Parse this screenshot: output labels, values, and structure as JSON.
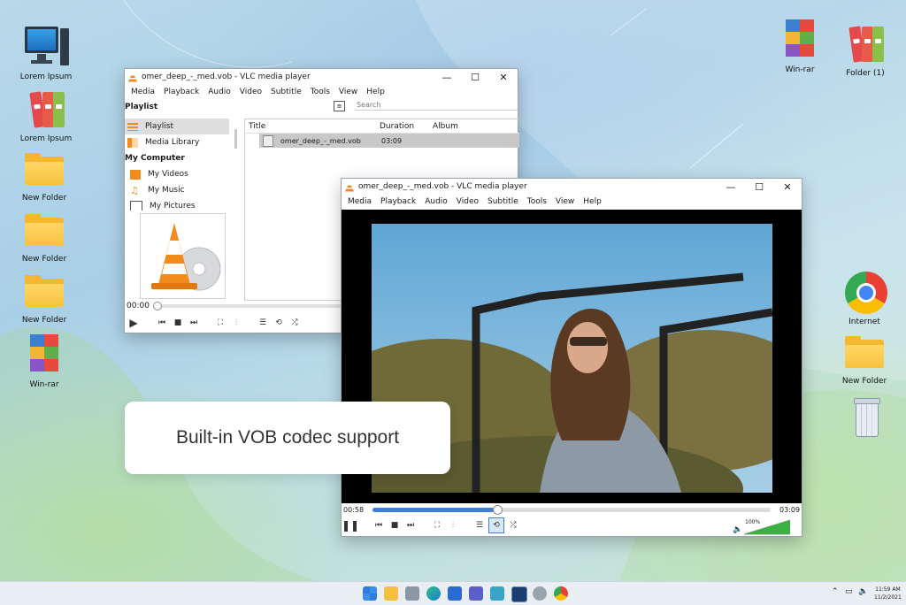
{
  "desktop": {
    "icons_left": [
      {
        "label": "Lorem Ipsum",
        "icon": "computer-icon"
      },
      {
        "label": "Lorem Ipsum",
        "icon": "binders-icon"
      },
      {
        "label": "New Folder",
        "icon": "folder-icon"
      },
      {
        "label": "New Folder",
        "icon": "folder-icon"
      },
      {
        "label": "New Folder",
        "icon": "folder-icon"
      },
      {
        "label": "Win-rar",
        "icon": "winrar-icon"
      }
    ],
    "icons_right": [
      {
        "label": "Win-rar",
        "icon": "winrar-icon"
      },
      {
        "label": "Folder (1)",
        "icon": "binders-icon"
      },
      {
        "label": "Internet",
        "icon": "chrome-icon"
      },
      {
        "label": "New Folder",
        "icon": "folder-icon"
      },
      {
        "label": "",
        "icon": "recycle-bin-icon"
      }
    ]
  },
  "playlist_window": {
    "title": "omer_deep_-_med.vob - VLC media player",
    "menu": [
      "Media",
      "Playback",
      "Audio",
      "Video",
      "Subtitle",
      "Tools",
      "View",
      "Help"
    ],
    "section_title": "Playlist",
    "search_placeholder": "Search",
    "sidebar": {
      "items": [
        "Playlist",
        "Media Library"
      ],
      "group": "My Computer",
      "computer_items": [
        "My Videos",
        "My Music",
        "My Pictures"
      ]
    },
    "columns": [
      "Title",
      "Duration",
      "Album"
    ],
    "rows": [
      {
        "title": "omer_deep_-_med.vob",
        "duration": "03:09",
        "album": ""
      }
    ],
    "time": "00:00"
  },
  "player_window": {
    "title": "omer_deep_-_med.vob - VLC media player",
    "menu": [
      "Media",
      "Playback",
      "Audio",
      "Video",
      "Subtitle",
      "Tools",
      "View",
      "Help"
    ],
    "time_elapsed": "00:58",
    "time_total": "03:09",
    "progress": 0.31,
    "volume_label": "100%",
    "volume": 1.0
  },
  "callout": {
    "text": "Built-in VOB codec support"
  },
  "taskbar": {
    "time": "11:59 AM",
    "date": "11/2/2021"
  },
  "colors": {
    "vlc_orange": "#f28a1c",
    "accent_blue": "#3d7fd6",
    "volume_green": "#3cb043"
  }
}
